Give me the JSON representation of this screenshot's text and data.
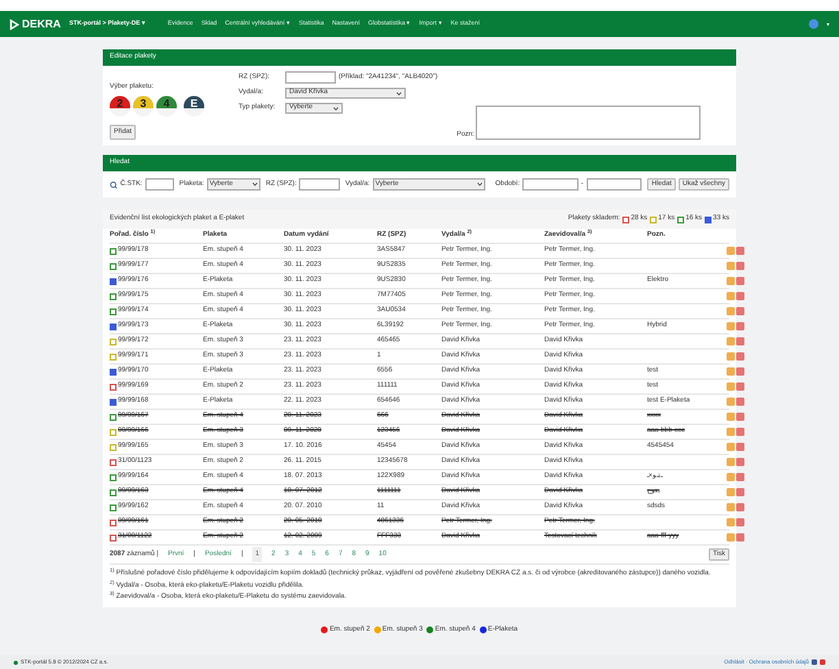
{
  "nav": {
    "brand": "DEKRA",
    "portal": "STK-portál > Plakety-DE",
    "portal_caret": "▾",
    "items": [
      {
        "label": "Evidence"
      },
      {
        "label": "Sklad"
      },
      {
        "label": "Centrální vyhledávání",
        "caret": "▾"
      },
      {
        "label": "Statistika"
      },
      {
        "label": "Nastavení"
      },
      {
        "label": "Globstatistika",
        "caret": "▾"
      },
      {
        "label": "Import",
        "caret": "▾"
      },
      {
        "label": "Ke stažení"
      }
    ],
    "user_caret": "▾"
  },
  "edit_panel": {
    "title": "Editace plakety",
    "choose_label": "Výber plaketu:",
    "plaques": [
      {
        "label": "2",
        "color": "#d81e1e"
      },
      {
        "label": "3",
        "color": "#e8c02a"
      },
      {
        "label": "4",
        "color": "#2f8a3a"
      },
      {
        "label": "E",
        "color": "#2e4a5e"
      }
    ],
    "button": "Přidat",
    "rz_label": "RZ (SPZ):",
    "rz_hint": "(Příklad: \"2A41234\", \"ALB4020\")",
    "issuer_label": "Vydal/a:",
    "issuer_value": "David Křivka",
    "type_label": "Typ plakety:",
    "type_value": "Vyberte",
    "note_label": "Pozn:"
  },
  "search_panel": {
    "title": "Hledat",
    "stk_label": "Č.STK:",
    "plaque_label": "Plaketa:",
    "plaque_value": "Vyberte",
    "rz_label": "RZ (SPZ):",
    "issuer_label": "Vydal/a:",
    "issuer_value": "Vyberte",
    "period_label": "Období:",
    "period_sep": "-",
    "buttons": [
      "Hledat",
      "Ukaž všechny"
    ]
  },
  "list": {
    "title": "Evidenční list ekologických plaket a E-plaket",
    "stock_label": "Plakety skladem:",
    "stock": [
      {
        "count": "28 ks",
        "color": "#d9534f",
        "kind": "eco"
      },
      {
        "count": "17 ks",
        "color": "#c9b92a",
        "kind": "eco"
      },
      {
        "count": "16 ks",
        "color": "#3c9a3c",
        "kind": "eco"
      },
      {
        "count": "33 ks",
        "color": "#3b5bd6",
        "kind": "e"
      }
    ],
    "columns": [
      "Pořad. číslo $^{1)}$",
      "Plaketa",
      "Datum vydání",
      "RZ (SPZ)",
      "Vydal/a $^{2)}$",
      "Zaevidoval/a $^{3)}$",
      "Pozn."
    ],
    "rows": [
      {
        "kind": "eco",
        "color": "#3c9a3c",
        "cancelled": false,
        "cells": [
          "99/99/178",
          "Em. stupeň 4",
          "30. 11. 2023",
          "3AS5847",
          "Petr Termer, Ing.",
          "Petr Termer, Ing.",
          ""
        ]
      },
      {
        "kind": "eco",
        "color": "#3c9a3c",
        "cancelled": false,
        "cells": [
          "99/99/177",
          "Em. stupeň 4",
          "30. 11. 2023",
          "9US2835",
          "Petr Termer, Ing.",
          "Petr Termer, Ing.",
          ""
        ]
      },
      {
        "kind": "e",
        "color": "#3b5bd6",
        "cancelled": false,
        "cells": [
          "99/99/176",
          "E-Plaketa",
          "30. 11. 2023",
          "9US2830",
          "Petr Termer, Ing.",
          "Petr Termer, Ing.",
          "Elektro"
        ]
      },
      {
        "kind": "eco",
        "color": "#3c9a3c",
        "cancelled": false,
        "cells": [
          "99/99/175",
          "Em. stupeň 4",
          "30. 11. 2023",
          "7M77405",
          "Petr Termer, Ing.",
          "Petr Termer, Ing.",
          ""
        ]
      },
      {
        "kind": "eco",
        "color": "#3c9a3c",
        "cancelled": false,
        "cells": [
          "99/99/174",
          "Em. stupeň 4",
          "30. 11. 2023",
          "3AU0534",
          "Petr Termer, Ing.",
          "Petr Termer, Ing.",
          ""
        ]
      },
      {
        "kind": "e",
        "color": "#3b5bd6",
        "cancelled": false,
        "cells": [
          "99/99/173",
          "E-Plaketa",
          "30. 11. 2023",
          "6L39192",
          "Petr Termer, Ing.",
          "Petr Termer, Ing.",
          "Hybrid"
        ]
      },
      {
        "kind": "eco",
        "color": "#c9b92a",
        "cancelled": false,
        "cells": [
          "99/99/172",
          "Em. stupeň 3",
          "23. 11. 2023",
          "465465",
          "David Křivka",
          "David Křivka",
          ""
        ]
      },
      {
        "kind": "eco",
        "color": "#c9b92a",
        "cancelled": false,
        "cells": [
          "99/99/171",
          "Em. stupeň 3",
          "23. 11. 2023",
          "1",
          "David Křivka",
          "David Křivka",
          ""
        ]
      },
      {
        "kind": "e",
        "color": "#3b5bd6",
        "cancelled": false,
        "cells": [
          "99/99/170",
          "E-Plaketa",
          "23. 11. 2023",
          "6556",
          "David Křivka",
          "David Křivka",
          "test"
        ]
      },
      {
        "kind": "eco",
        "color": "#d9534f",
        "cancelled": false,
        "cells": [
          "99/99/169",
          "Em. stupeň 2",
          "23. 11. 2023",
          "111111",
          "David Křivka",
          "David Křivka",
          "test"
        ]
      },
      {
        "kind": "e",
        "color": "#3b5bd6",
        "cancelled": false,
        "cells": [
          "99/99/168",
          "E-Plaketa",
          "22. 11. 2023",
          "654646",
          "David Křivka",
          "David Křivka",
          "test E-Plaketa"
        ]
      },
      {
        "kind": "eco",
        "color": "#3c9a3c",
        "cancelled": true,
        "cells": [
          "99/99/167",
          "Em. stupeň 4",
          "20. 11. 2023",
          "666",
          "David Křivka",
          "David Křivka",
          "xxxx"
        ]
      },
      {
        "kind": "eco",
        "color": "#c9b92a",
        "cancelled": true,
        "cells": [
          "99/99/166",
          "Em. stupeň 3",
          "09. 11. 2020",
          "123456",
          "David Křivka",
          "David Křivka",
          "aaa-bbb-ccc"
        ]
      },
      {
        "kind": "eco",
        "color": "#c9b92a",
        "cancelled": false,
        "cells": [
          "99/99/165",
          "Em. stupeň 3",
          "17. 10. 2016",
          "45454",
          "David Křivka",
          "David Křivka",
          "4545454"
        ]
      },
      {
        "kind": "eco",
        "color": "#d9534f",
        "cancelled": false,
        "cells": [
          "31/00/1123",
          "Em. stupeň 2",
          "26. 11. 2015",
          "12345678",
          "David Křivka",
          "David Křivka",
          ""
        ]
      },
      {
        "kind": "eco",
        "color": "#3c9a3c",
        "cancelled": false,
        "cells": [
          "99/99/164",
          "Em. stupeň 4",
          "18. 07. 2013",
          "122X989",
          "David Křivka",
          "David Křivka",
          "ـتـو×ـ"
        ]
      },
      {
        "kind": "eco",
        "color": "#3c9a3c",
        "cancelled": true,
        "cells": [
          "99/99/163",
          "Em. stupeň 4",
          "18. 07. 2012",
          "1111111",
          "David Křivka",
          "David Křivka",
          "ـتوج"
        ]
      },
      {
        "kind": "eco",
        "color": "#3c9a3c",
        "cancelled": false,
        "cells": [
          "99/99/162",
          "Em. stupeň 4",
          "20. 07. 2010",
          "11",
          "David Křivka",
          "David Křivka",
          "sdsds"
        ]
      },
      {
        "kind": "eco",
        "color": "#d9534f",
        "cancelled": true,
        "cells": [
          "99/99/161",
          "Em. stupeň 2",
          "20. 05. 2010",
          "4861336",
          "Petr Termer, Ing.",
          "Petr Termer, Ing.",
          ""
        ]
      },
      {
        "kind": "eco",
        "color": "#d9534f",
        "cancelled": true,
        "cells": [
          "31/00/1122",
          "Em. stupeň 2",
          "12. 02. 2009",
          "FFF333",
          "David Křivka",
          "Testovací technik",
          "aaa-fff-yyy"
        ]
      }
    ],
    "total": "2087",
    "total_label": "záznamů |",
    "first": "První",
    "sep": "|",
    "last": "Poslední",
    "sep2": "|",
    "pages": [
      {
        "label": "1",
        "selected": true
      },
      {
        "label": "2",
        "selected": false
      },
      {
        "label": "3",
        "selected": false
      },
      {
        "label": "4",
        "selected": false
      },
      {
        "label": "5",
        "selected": false
      },
      {
        "label": "6",
        "selected": false
      },
      {
        "label": "7",
        "selected": false
      },
      {
        "label": "8",
        "selected": false
      },
      {
        "label": "9",
        "selected": false
      },
      {
        "label": "10",
        "selected": false
      }
    ],
    "print": "Tisk",
    "notes": [
      "$^{1)}$ Příslušné pořadové číslo přidělujeme k odpovídajícím kopiím dokladů (technický průkaz, vyjádření od pověřené zkušebny DEKRA CZ a.s. či od výrobce (akreditovaného zástupce)) daného vozidla.",
      "$^{2)}$ Vydal/a - Osoba, která eko-plaketu/E-Plaketu vozidlu přidělila.",
      "$^{3)}$ Zaevidoval/a - Osoba, která eko-plaketu/E-Plaketu do systému zaevidovala."
    ]
  },
  "legend": [
    {
      "label": "Em. stupeň 2",
      "color": "#e31b1b"
    },
    {
      "label": "Em. stupeň 3",
      "color": "#f5a800"
    },
    {
      "label": "Em. stupeň 4",
      "color": "#16821f"
    },
    {
      "label": "E-Plaketa",
      "color": "#1428e0"
    }
  ],
  "footer": {
    "left": "STK-portál 5.8 © 2012/2024 CZ a.s.",
    "right": "Odhlásit · Ochrana osobních údajů"
  }
}
